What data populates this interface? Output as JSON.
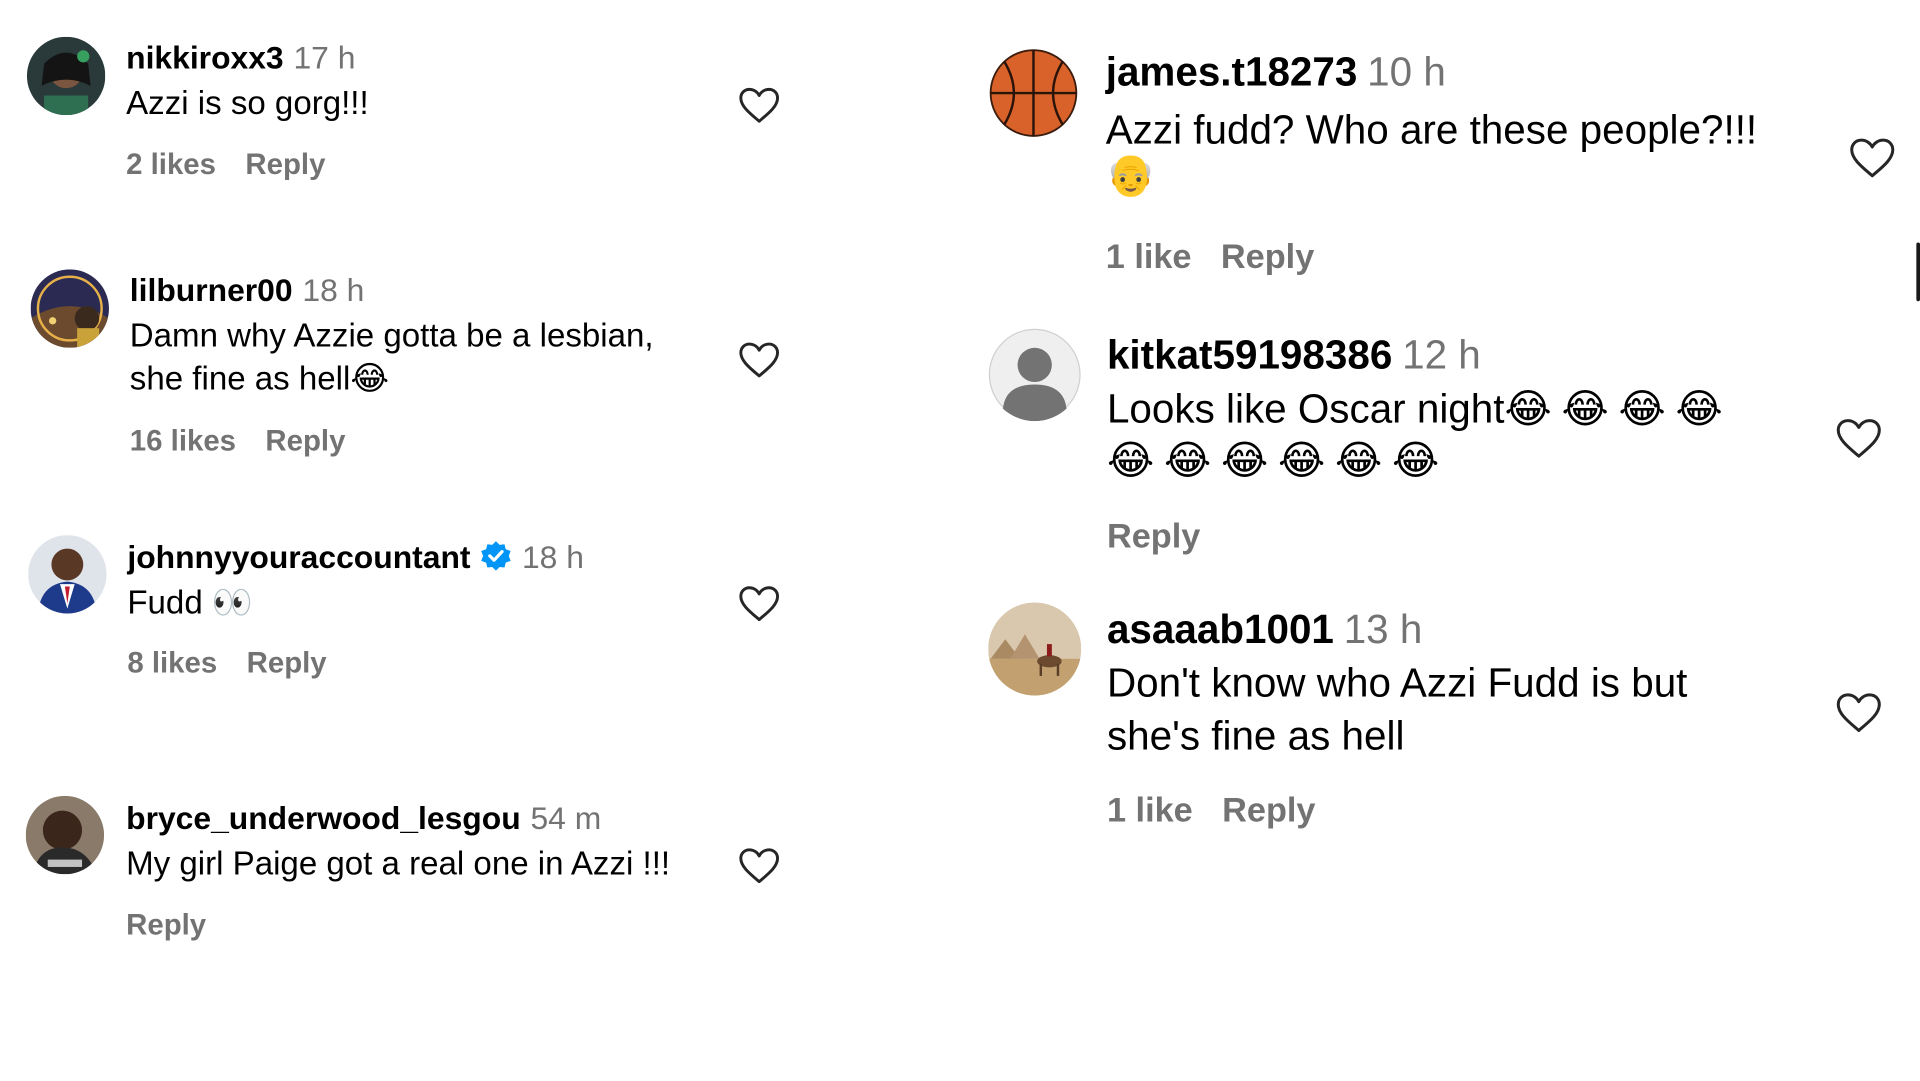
{
  "comments": [
    {
      "user": "nikkiroxx3",
      "time": "17 h",
      "text": "Azzi is so gorg!!!",
      "likes": "2 likes",
      "reply": "Reply"
    },
    {
      "user": "lilburner00",
      "time": "18 h",
      "text1": "Damn why Azzie gotta be a lesbian,",
      "text2": "she fine as hell",
      "emoji": "😂",
      "likes": "16 likes",
      "reply": "Reply"
    },
    {
      "user": "johnnyyouraccountant",
      "time": "18 h",
      "text": "Fudd",
      "emoji": "👀",
      "verified": true,
      "likes": "8 likes",
      "reply": "Reply"
    },
    {
      "user": "bryce_underwood_lesgou",
      "time": "54 m",
      "text": "My girl Paige got a real one in Azzi !!!",
      "reply": "Reply"
    },
    {
      "user": "james.t18273",
      "time": "10 h",
      "text": "Azzi fudd? Who are these people?!!!",
      "emoji": "👴",
      "likes": "1 like",
      "reply": "Reply"
    },
    {
      "user": "kitkat59198386",
      "time": "12 h",
      "text": "Looks like Oscar night",
      "emoji": "😂",
      "emoji_count_line1": 4,
      "emoji_count_line2": 6,
      "reply": "Reply"
    },
    {
      "user": "asaaab1001",
      "time": "13 h",
      "text1": "Don't know who Azzi Fudd is but",
      "text2": "she's fine as hell",
      "likes": "1 like",
      "reply": "Reply"
    }
  ],
  "colors": {
    "secondary_text": "#737373",
    "verified_blue": "#0095f6",
    "heart_stroke": "#262626"
  },
  "icons": {
    "like": "heart-outline-icon",
    "verified": "verified-badge-icon",
    "default_avatar": "default-user-icon"
  }
}
